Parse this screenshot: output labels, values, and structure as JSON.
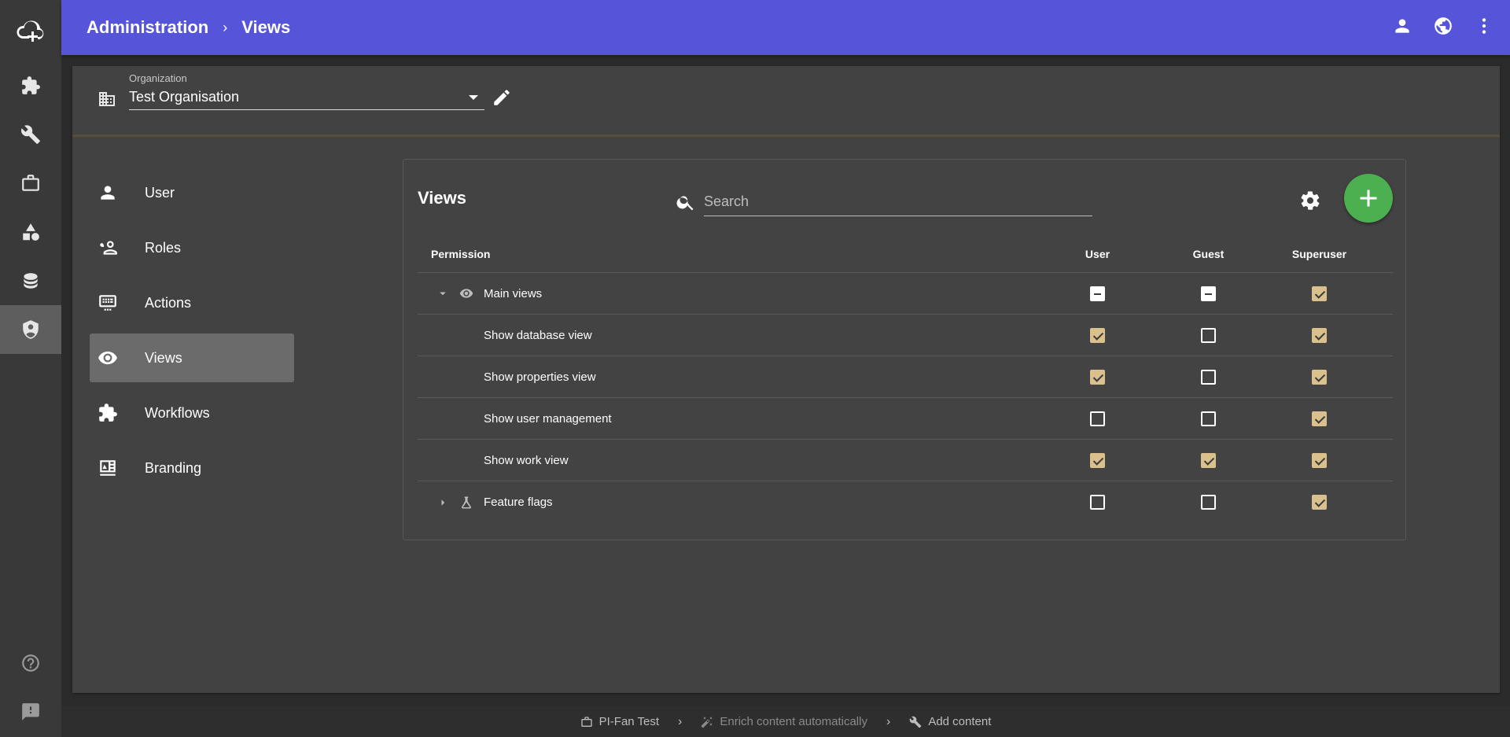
{
  "rail": {
    "items": [
      {
        "icon": "puzzle-icon"
      },
      {
        "icon": "wrench-icon"
      },
      {
        "icon": "briefcase-icon"
      },
      {
        "icon": "shapes-icon"
      },
      {
        "icon": "database-icon"
      },
      {
        "icon": "shield-account-icon",
        "active": true
      }
    ],
    "bottom": [
      {
        "icon": "help-icon"
      },
      {
        "icon": "feedback-icon"
      }
    ]
  },
  "header": {
    "breadcrumb": [
      "Administration",
      "Views"
    ],
    "separator": "›"
  },
  "organization": {
    "label": "Organization",
    "value": "Test Organisation"
  },
  "subnav": {
    "items": [
      {
        "label": "User",
        "icon": "person-icon"
      },
      {
        "label": "Roles",
        "icon": "role-icon"
      },
      {
        "label": "Actions",
        "icon": "keyboard-icon"
      },
      {
        "label": "Views",
        "icon": "eye-icon",
        "active": true
      },
      {
        "label": "Workflows",
        "icon": "puzzle-icon"
      },
      {
        "label": "Branding",
        "icon": "branding-icon"
      }
    ]
  },
  "views": {
    "title": "Views",
    "search": {
      "placeholder": "Search",
      "value": ""
    },
    "columns": [
      "Permission",
      "User",
      "Guest",
      "Superuser"
    ],
    "rows": [
      {
        "label": "Main views",
        "group": true,
        "expanded": true,
        "icon": "eye-icon",
        "states": [
          "indeterminate",
          "indeterminate",
          "checked"
        ]
      },
      {
        "label": "Show database view",
        "states": [
          "checked",
          "unchecked",
          "checked"
        ]
      },
      {
        "label": "Show properties view",
        "states": [
          "checked",
          "unchecked",
          "checked"
        ]
      },
      {
        "label": "Show user management",
        "states": [
          "unchecked",
          "unchecked",
          "checked"
        ]
      },
      {
        "label": "Show work view",
        "states": [
          "checked",
          "checked",
          "checked"
        ]
      },
      {
        "label": "Feature flags",
        "group": true,
        "expanded": false,
        "icon": "flask-icon",
        "states": [
          "unchecked",
          "unchecked",
          "checked"
        ]
      }
    ]
  },
  "footer": {
    "steps": [
      {
        "label": "PI-Fan Test",
        "icon": "briefcase-icon"
      },
      {
        "label": "Enrich content automatically",
        "icon": "magic-wand-icon",
        "muted": true
      },
      {
        "label": "Add content",
        "icon": "wrench-icon"
      }
    ],
    "separator": "›"
  },
  "colors": {
    "topbar": "#5654d8",
    "add_button": "#4caf50",
    "checkbox_checked": "#d9c08c",
    "panel": "#424242"
  }
}
